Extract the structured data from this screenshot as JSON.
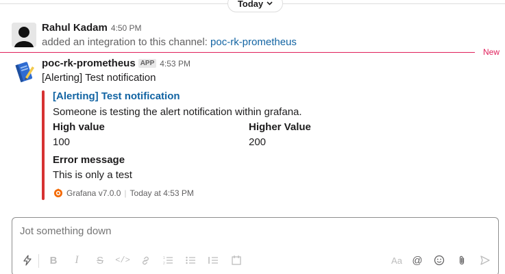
{
  "date_divider": {
    "label": "Today"
  },
  "messages": [
    {
      "author": "Rahul Kadam",
      "time": "4:50 PM",
      "text_prefix": "added an integration to this channel: ",
      "channel_link": "poc-rk-prometheus"
    },
    {
      "author": "poc-rk-prometheus",
      "badge": "APP",
      "time": "4:53 PM",
      "text": "[Alerting] Test notification",
      "attachment": {
        "color": "#d63232",
        "title": "[Alerting] Test notification",
        "text": "Someone is testing the alert notification within grafana.",
        "fields": [
          {
            "title": "High value",
            "value": "100"
          },
          {
            "title": "Higher Value",
            "value": "200"
          }
        ],
        "error_title": "Error message",
        "error_value": "This is only a test",
        "footer": "Grafana v7.0.0",
        "footer_time": "Today at 4:53 PM"
      }
    }
  ],
  "new_divider": {
    "label": "New"
  },
  "composer": {
    "placeholder": "Jot something down",
    "toolbar": [
      "shortcuts-icon",
      "bold-icon",
      "italic-icon",
      "strikethrough-icon",
      "code-icon",
      "link-icon",
      "ordered-list-icon",
      "bulleted-list-icon",
      "blockquote-icon",
      "code-block-icon",
      "formatting-icon",
      "mention-icon",
      "emoji-icon",
      "attach-icon",
      "send-icon"
    ]
  },
  "colors": {
    "link": "#1264a3",
    "new": "#e01e5a",
    "attachment_bar": "#d63232"
  }
}
